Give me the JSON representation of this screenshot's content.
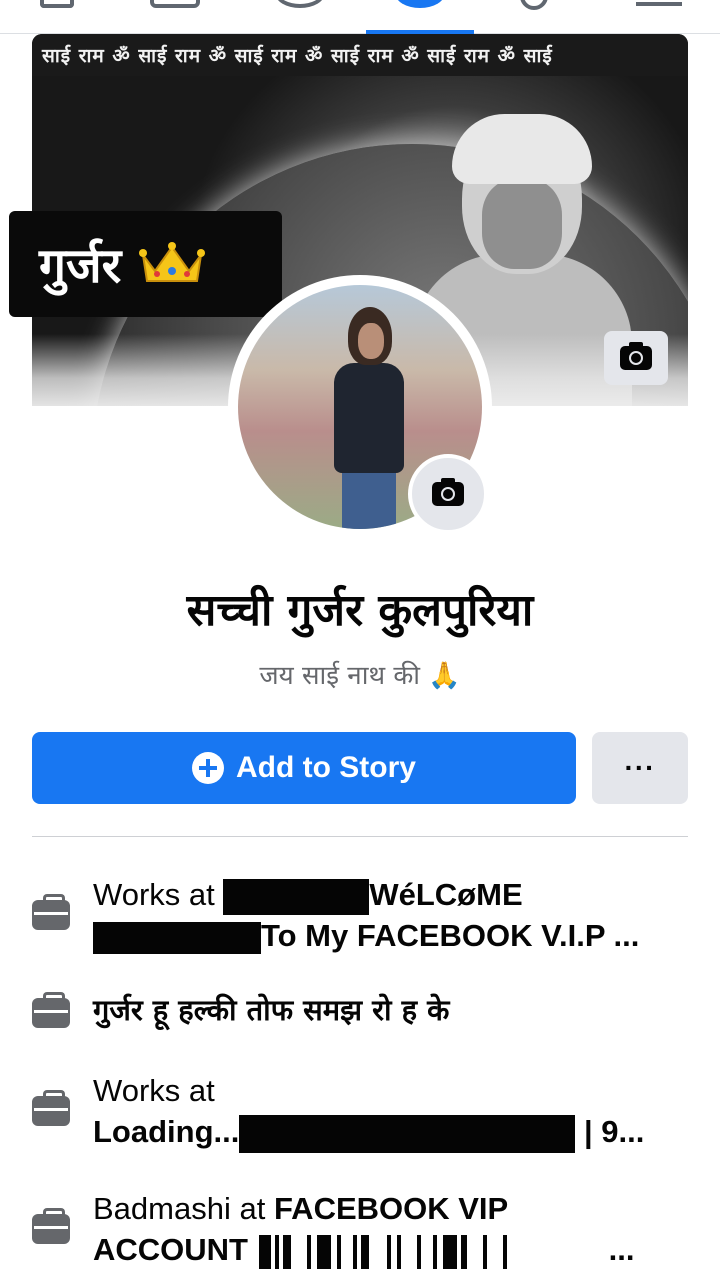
{
  "nav": {
    "tabs": [
      "home",
      "watch",
      "groups",
      "profile",
      "notifications",
      "menu"
    ],
    "active_tab": "profile"
  },
  "cover": {
    "banner_text": "साई राम ॐ साई राम ॐ साई राम ॐ साई राम ॐ साई राम ॐ साई"
  },
  "tag": {
    "text": "गुर्जर",
    "emoji": "👑"
  },
  "profile": {
    "name": "सच्ची गुर्जर कुलपुरिया",
    "bio": "जय साई नाथ की 🙏"
  },
  "actions": {
    "add_story_label": "Add to Story",
    "more_label": "···"
  },
  "info": [
    {
      "prefix": "Works at",
      "line1_bold": "WéLCøME",
      "line2_bold": "To My FACEBOOK V.I.P ..."
    },
    {
      "text": "गुर्जर हू हल्की तोफ समझ रो ह के"
    },
    {
      "prefix": "Works at",
      "line2_bold_start": "Loading...",
      "line2_bold_end": "| 9..."
    },
    {
      "prefix": "Badmashi at",
      "line1_bold": "FACEBOOK VIP",
      "line2_bold": "ACCOUNT",
      "line2_tail": "..."
    }
  ],
  "colors": {
    "accent": "#1877f2",
    "secondary_button": "#e4e6eb",
    "muted_text": "#65676b"
  }
}
